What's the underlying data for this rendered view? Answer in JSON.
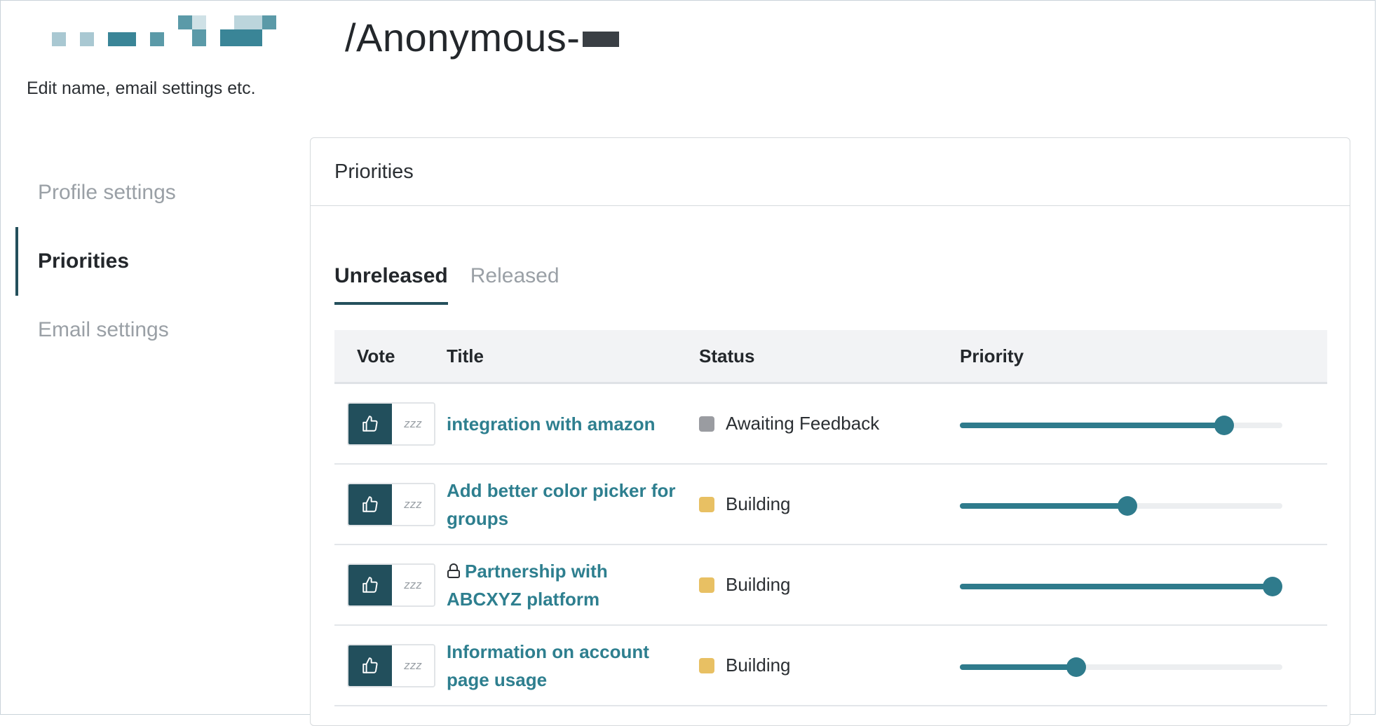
{
  "header": {
    "title": "/Anonymous-",
    "subtitle": "Edit name, email settings etc."
  },
  "sidebar": {
    "items": [
      {
        "label": "Profile settings",
        "active": false
      },
      {
        "label": "Priorities",
        "active": true
      },
      {
        "label": "Email settings",
        "active": false
      }
    ]
  },
  "card": {
    "title": "Priorities",
    "tabs": [
      {
        "label": "Unreleased",
        "active": true
      },
      {
        "label": "Released",
        "active": false
      }
    ],
    "table": {
      "columns": [
        "Vote",
        "Title",
        "Status",
        "Priority"
      ],
      "rows": [
        {
          "title": "integration with amazon",
          "locked": false,
          "status": "Awaiting Feedback",
          "status_color": "#9a9ca1",
          "priority": 0.82,
          "snooze_label": "zzz"
        },
        {
          "title": "Add better color picker for groups",
          "locked": false,
          "status": "Building",
          "status_color": "#e8c063",
          "priority": 0.52,
          "snooze_label": "zzz"
        },
        {
          "title": "Partnership with ABCXYZ platform",
          "locked": true,
          "status": "Building",
          "status_color": "#e8c063",
          "priority": 0.97,
          "snooze_label": "zzz"
        },
        {
          "title": "Information on account page usage",
          "locked": false,
          "status": "Building",
          "status_color": "#e8c063",
          "priority": 0.36,
          "snooze_label": "zzz"
        }
      ]
    }
  },
  "colors": {
    "accent": "#24505c",
    "link": "#2e7f8f",
    "slider": "#2f7b8c"
  },
  "icons": {
    "vote_up": "thumbs-up-icon",
    "snooze": "snooze-icon",
    "lock": "lock-icon"
  }
}
